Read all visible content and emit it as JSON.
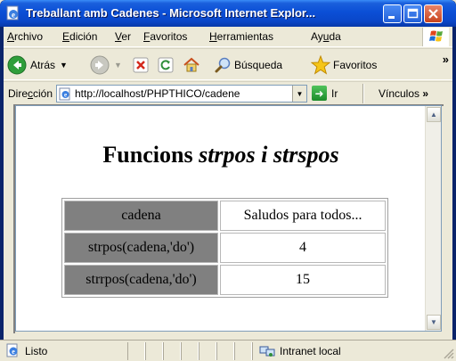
{
  "window": {
    "title": "Treballant amb Cadenes - Microsoft Internet Explor...",
    "icon": "ie-page-icon"
  },
  "menu": {
    "items": [
      {
        "pre": "",
        "key": "A",
        "post": "rchivo"
      },
      {
        "pre": "",
        "key": "E",
        "post": "dición"
      },
      {
        "pre": "",
        "key": "V",
        "post": "er"
      },
      {
        "pre": "",
        "key": "F",
        "post": "avoritos"
      },
      {
        "pre": "",
        "key": "H",
        "post": "erramientas"
      },
      {
        "pre": "Ay",
        "key": "u",
        "post": "da"
      }
    ]
  },
  "toolbar": {
    "back_label": "Atrás",
    "search_label": "Búsqueda",
    "favorites_label": "Favoritos"
  },
  "address": {
    "label_pre": "Dire",
    "label_key": "c",
    "label_post": "ción",
    "url": "http://localhost/PHPTHICO/cadene",
    "go_label": "Ir",
    "links_label": "Vínculos"
  },
  "page": {
    "title_plain": "Funcions ",
    "title_italic": "strpos i strspos",
    "rows": [
      {
        "label": "cadena",
        "value": "Saludos para todos..."
      },
      {
        "label": "strpos(cadena,'do')",
        "value": "4"
      },
      {
        "label": "strrpos(cadena,'do')",
        "value": "15"
      }
    ]
  },
  "status": {
    "text": "Listo",
    "zone": "Intranet local"
  },
  "colors": {
    "title_bar": "#0b4fd6",
    "chrome": "#ece9d8",
    "label_cell": "#808080"
  }
}
